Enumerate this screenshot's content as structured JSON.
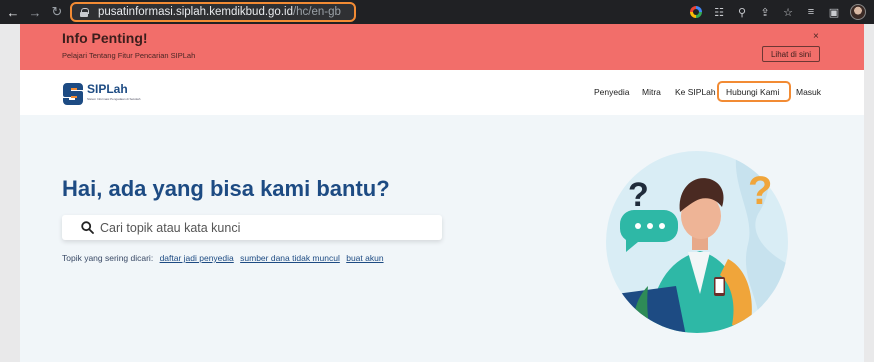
{
  "browser": {
    "url_host": "pusatinformasi.siplah.kemdikbud.go.id",
    "url_path": "/hc/en-gb"
  },
  "banner": {
    "title": "Info Penting!",
    "subtitle": "Pelajari Tentang Fitur Pencarian SIPLah",
    "close": "×",
    "button": "Lihat di sini"
  },
  "header": {
    "logo_text": "SIPLah",
    "logo_tagline": "Sistem Informasi Pengadaan di Sekolah",
    "nav": [
      "Penyedia",
      "Mitra",
      "Ke SIPLah",
      "Hubungi Kami",
      "Masuk"
    ]
  },
  "hero": {
    "title": "Hai, ada yang bisa kami bantu?",
    "search_placeholder": "Cari topik atau kata kunci",
    "popular_label": "Topik yang sering dicari:",
    "popular_links": [
      "daftar jadi penyedia",
      "sumber dana tidak muncul",
      "buat akun"
    ]
  },
  "colors": {
    "banner_bg": "#f26e6a",
    "brand_blue": "#1d4b83",
    "highlight": "#f28b34"
  }
}
